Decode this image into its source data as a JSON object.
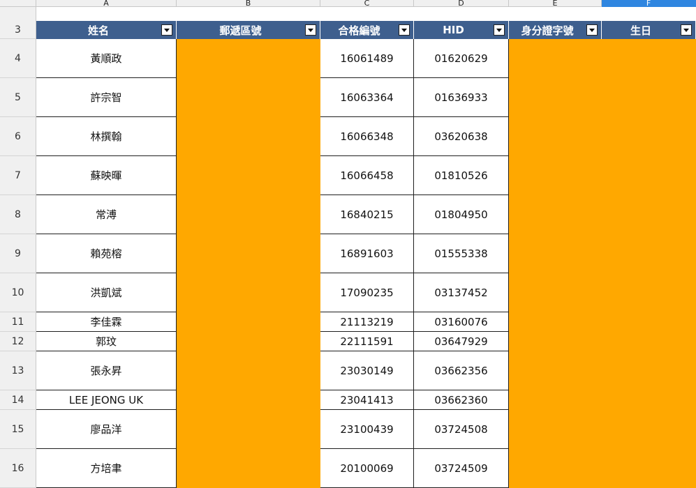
{
  "sheet": {
    "columns": [
      {
        "letter": "A",
        "header": "姓名"
      },
      {
        "letter": "B",
        "header": "郵遞區號"
      },
      {
        "letter": "C",
        "header": "合格編號"
      },
      {
        "letter": "D",
        "header": "HID"
      },
      {
        "letter": "E",
        "header": "身分證字號"
      },
      {
        "letter": "F",
        "header": "生日"
      }
    ],
    "selected_column": "F",
    "header_row_number": "3",
    "rows": [
      {
        "num": "4",
        "name": "黃順政",
        "cert": "16061489",
        "hid": "01620629"
      },
      {
        "num": "5",
        "name": "許宗智",
        "cert": "16063364",
        "hid": "01636933"
      },
      {
        "num": "6",
        "name": "林撰翰",
        "cert": "16066348",
        "hid": "03620638"
      },
      {
        "num": "7",
        "name": "蘇映暉",
        "cert": "16066458",
        "hid": "01810526"
      },
      {
        "num": "8",
        "name": "常溥",
        "cert": "16840215",
        "hid": "01804950"
      },
      {
        "num": "9",
        "name": "賴苑榕",
        "cert": "16891603",
        "hid": "01555338"
      },
      {
        "num": "10",
        "name": "洪凱斌",
        "cert": "17090235",
        "hid": "03137452"
      },
      {
        "num": "11",
        "name": "李佳霖",
        "cert": "21113219",
        "hid": "03160076"
      },
      {
        "num": "12",
        "name": "郭玟",
        "cert": "22111591",
        "hid": "03647929"
      },
      {
        "num": "13",
        "name": "張永昇",
        "cert": "23030149",
        "hid": "03662356"
      },
      {
        "num": "14",
        "name": "LEE JEONG UK",
        "cert": "23041413",
        "hid": "03662360"
      },
      {
        "num": "15",
        "name": "廖品洋",
        "cert": "23100439",
        "hid": "03724508"
      },
      {
        "num": "16",
        "name": "方培聿",
        "cert": "20100069",
        "hid": "03724509"
      }
    ],
    "colors": {
      "header_bg": "#3e5f8e",
      "highlight": "#ffa800",
      "selected_column": "#2f86e0"
    }
  }
}
